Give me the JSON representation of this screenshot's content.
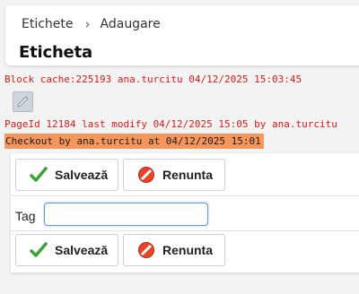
{
  "breadcrumb": {
    "parent": "Etichete",
    "current": "Adaugare"
  },
  "page_title": "Eticheta",
  "cache_info": "Block cache:225193 ana.turcitu 04/12/2025 15:03:45",
  "page_info": "PageId 12184 last modify 04/12/2025 15:05 by ana.turcitu",
  "checkout_info": "Checkout by ana.turcitu at 04/12/2025 15:01",
  "form": {
    "save_label": "Salvează",
    "cancel_label": "Renunta",
    "tag_label": "Tag",
    "tag_value": ""
  },
  "colors": {
    "info_red": "#d81c1c",
    "checkout_bg": "#f5965c",
    "save_check": "#3aa335",
    "cancel_red": "#e8442a"
  },
  "icons": {
    "save": "check-icon",
    "cancel": "forbidden-icon",
    "edit": "pencil-icon",
    "separator": "chevron-right-icon"
  }
}
